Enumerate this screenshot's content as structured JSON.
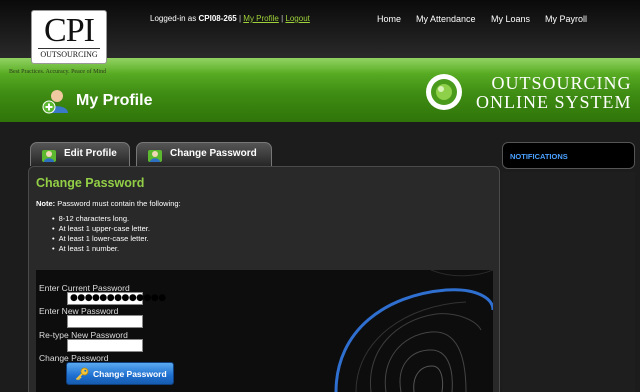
{
  "header": {
    "logo_main": "CPI",
    "logo_sub": "OUTSOURCING",
    "tagline": "Best Practices.  Accuracy.  Peace of Mind",
    "session_prefix": "Logged-in as",
    "username": "CPI08-265",
    "my_profile_link": "My Profile",
    "logout_link": "Logout",
    "separator": "|",
    "nav": [
      {
        "label": "Home"
      },
      {
        "label": "My Attendance"
      },
      {
        "label": "My Loans"
      },
      {
        "label": "My Payroll"
      }
    ]
  },
  "banner": {
    "page_title": "My Profile",
    "system_line1": "OUTSOURCING",
    "system_line2": "ONLINE SYSTEM"
  },
  "tabs": [
    {
      "label": "Edit Profile"
    },
    {
      "label": "Change Password"
    }
  ],
  "panel": {
    "title": "Change Password",
    "note_label": "Note:",
    "note_text": " Password must contain the following:",
    "rules": [
      "8-12 characters long.",
      "At least 1 upper-case letter.",
      "At least 1 lower-case letter.",
      "At least 1 number."
    ]
  },
  "form": {
    "current_label": "Enter Current Password",
    "current_value": "●●●●●●●●●●●●●",
    "new_label": "Enter New Password",
    "new_value": "",
    "retype_label": "Re-type New Password",
    "retype_value": "",
    "change_label": "Change Password",
    "button_label": "Change Password"
  },
  "notifications": {
    "title": "NOTIFICATIONS"
  },
  "colors": {
    "accent_green": "#93cf46",
    "banner_green": "#3f8d14",
    "button_blue": "#1f6fd0",
    "notif_blue": "#4aa0ff"
  }
}
